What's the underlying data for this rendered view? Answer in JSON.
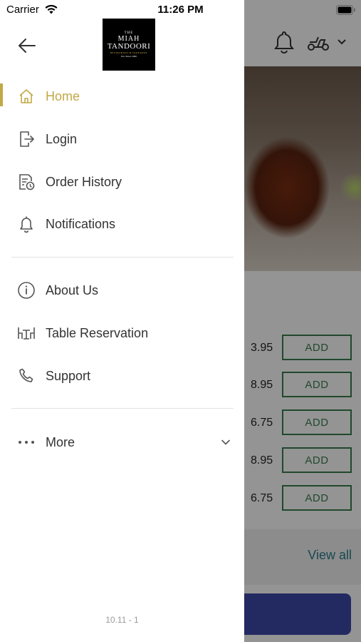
{
  "status_bar": {
    "carrier": "Carrier",
    "time": "11:26 PM"
  },
  "logo": {
    "line1": "THE",
    "line2": "MIAH",
    "line3": "TANDOORI",
    "line4": "RESTAURANT & TAKEAWAY",
    "line5": "Est. Since 1990"
  },
  "nav": {
    "primary": [
      {
        "label": "Home",
        "icon": "home-icon",
        "active": true
      },
      {
        "label": "Login",
        "icon": "login-icon"
      },
      {
        "label": "Order History",
        "icon": "order-history-icon"
      },
      {
        "label": "Notifications",
        "icon": "bell-icon"
      }
    ],
    "secondary": [
      {
        "label": "About Us",
        "icon": "info-icon"
      },
      {
        "label": "Table Reservation",
        "icon": "table-icon"
      },
      {
        "label": "Support",
        "icon": "phone-icon"
      }
    ],
    "more": {
      "label": "More",
      "icon": "more-dots-icon"
    }
  },
  "version": "10.11 - 1",
  "background": {
    "menu_items": [
      {
        "price": "3.95",
        "button": "ADD"
      },
      {
        "price": "8.95",
        "button": "ADD"
      },
      {
        "price": "6.75",
        "button": "ADD"
      },
      {
        "price": "8.95",
        "button": "ADD"
      },
      {
        "price": "6.75",
        "button": "ADD"
      }
    ],
    "view_all": "View all"
  },
  "colors": {
    "accent": "#c2a846",
    "text": "#333333",
    "add_green": "#3a7d4f",
    "cta_blue": "#3d49a8",
    "link_teal": "#2a7f8a"
  }
}
